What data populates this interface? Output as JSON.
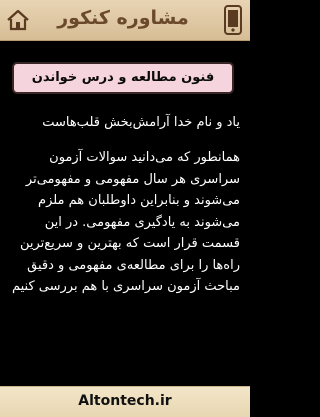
{
  "header": {
    "title": "مشاوره کنکور"
  },
  "section": {
    "title": "فنون مطالعه و درس خواندن"
  },
  "content": {
    "intro": "یاد و نام خدا آرامش‌بخش قلب‌هاست",
    "lines": [
      "همانطور که می‌دانید سوالات آزمون",
      "سراسری هر سال مفهومی و مفهومی‌تر",
      "می‌شوند و بنابراین داوطلبان هم ملزم",
      "می‌شوند به یادگیری مفهومی. در این",
      "قسمت قرار است که بهترین و سریع‌ترین",
      "راه‌ها را برای مطالعه‌ی مفهومی و دقیق",
      "مباحث آزمون سراسری با هم بررسی کنیم"
    ]
  },
  "footer": {
    "site": "Altontech.ir"
  },
  "icons": {
    "left": "home-icon",
    "right": "phone-icon"
  },
  "colors": {
    "header_bg": "#dcc39c",
    "title_text": "#6b4a2b",
    "section_bg": "#f6d4de",
    "body_bg": "#000000",
    "footer_bg": "#efe1c2"
  }
}
